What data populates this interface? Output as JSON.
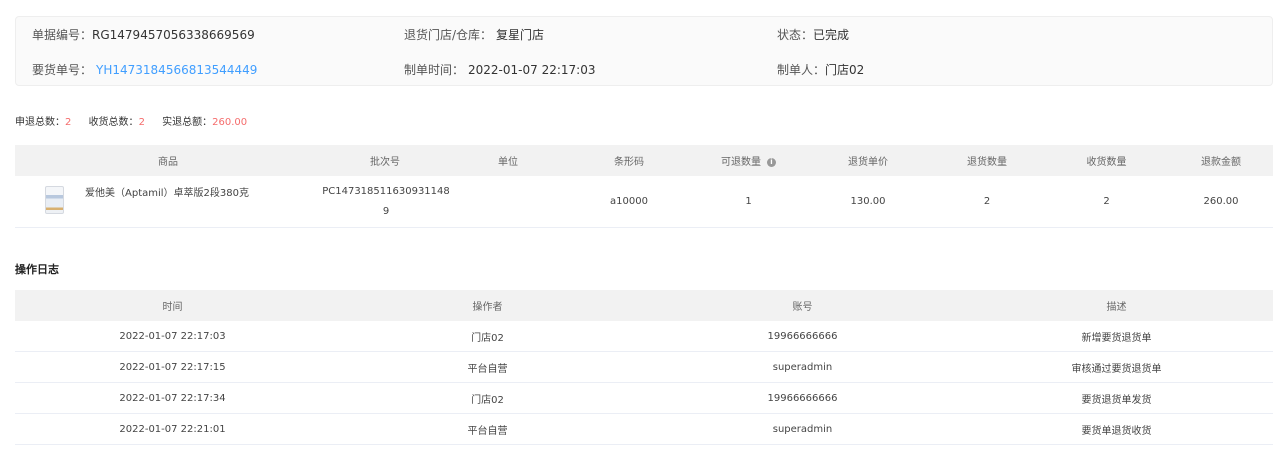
{
  "order_info": {
    "doc_no_label": "单据编号：",
    "doc_no": "RG1479457056338669569",
    "store_label": "退货门店/仓库：",
    "store": "复星门店",
    "status_label": "状态：",
    "status": "已完成",
    "request_no_label": "要货单号：",
    "request_no": "YH1473184566813544449",
    "created_time_label": "制单时间：",
    "created_time": "2022-01-07 22:17:03",
    "creator_label": "制单人：",
    "creator": "门店02"
  },
  "summary": {
    "apply_total_label": "申退总数：",
    "apply_total": "2",
    "received_total_label": "收货总数：",
    "received_total": "2",
    "actual_amount_label": "实退总额：",
    "actual_amount": "260.00"
  },
  "goods_table": {
    "columns": [
      "商品",
      "批次号",
      "单位",
      "条形码",
      "可退数量",
      "退货单价",
      "退货数量",
      "收货数量",
      "退款金额"
    ],
    "rows": [
      {
        "product_name": "爱他美（Aptamil）卓萃版2段380克",
        "product_image_icon": "milk-powder-can-icon",
        "batch_no": "PC1473185116309311489",
        "unit": "",
        "barcode": "a10000",
        "returnable_qty": "1",
        "unit_price": "130.00",
        "return_qty": "2",
        "received_qty": "2",
        "refund_amount": "260.00"
      }
    ]
  },
  "log_section": {
    "title": "操作日志",
    "columns": [
      "时间",
      "操作者",
      "账号",
      "描述"
    ],
    "rows": [
      [
        "2022-01-07 22:17:03",
        "门店02",
        "19966666666",
        "新增要货退货单"
      ],
      [
        "2022-01-07 22:17:15",
        "平台自营",
        "superadmin",
        "审核通过要货退货单"
      ],
      [
        "2022-01-07 22:17:34",
        "门店02",
        "19966666666",
        "要货退货单发货"
      ],
      [
        "2022-01-07 22:21:01",
        "平台自营",
        "superadmin",
        "要货单退货收货"
      ]
    ]
  },
  "colors": {
    "link": "#409eff",
    "highlight": "#f56c6c",
    "header_bg": "#f2f2f2"
  }
}
